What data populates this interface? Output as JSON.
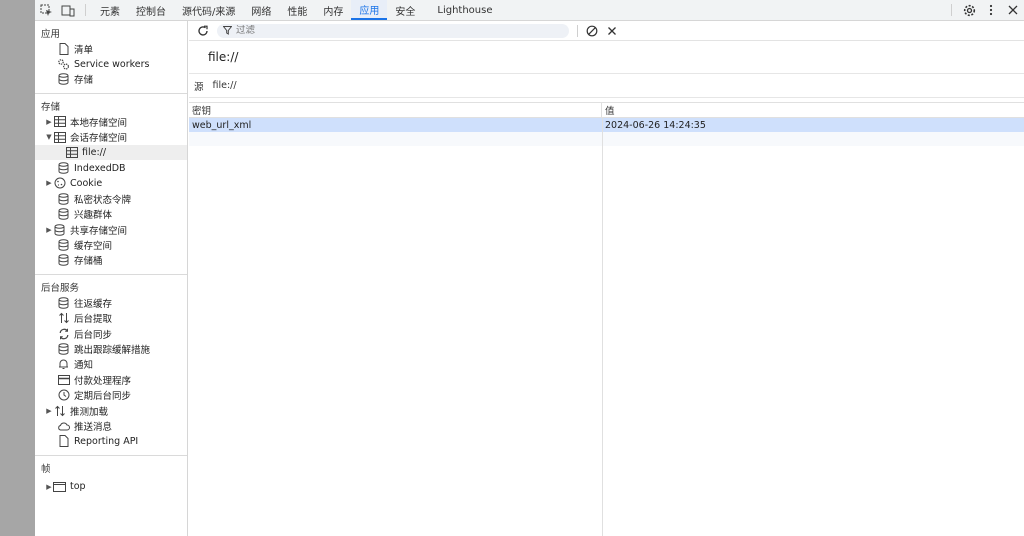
{
  "toolbar": {
    "tabs": [
      {
        "label": "元素"
      },
      {
        "label": "控制台"
      },
      {
        "label": "源代码/来源"
      },
      {
        "label": "网络"
      },
      {
        "label": "性能"
      },
      {
        "label": "内存"
      },
      {
        "label": "应用"
      },
      {
        "label": "安全"
      },
      {
        "label": "Lighthouse"
      }
    ],
    "active_tab": "应用"
  },
  "sidebar": {
    "app": {
      "title": "应用",
      "items": [
        {
          "label": "清单",
          "icon": "file-icon"
        },
        {
          "label": "Service workers",
          "icon": "gears-icon"
        },
        {
          "label": "存储",
          "icon": "database-icon"
        }
      ]
    },
    "storage": {
      "title": "存储",
      "items": [
        {
          "label": "本地存储空间",
          "icon": "table-icon"
        },
        {
          "label": "会话存储空间",
          "icon": "table-icon"
        },
        {
          "label": "file://",
          "icon": "table-icon"
        },
        {
          "label": "IndexedDB",
          "icon": "database-icon"
        },
        {
          "label": "Cookie",
          "icon": "cookie-icon"
        },
        {
          "label": "私密状态令牌",
          "icon": "database-icon"
        },
        {
          "label": "兴趣群体",
          "icon": "database-icon"
        },
        {
          "label": "共享存储空间",
          "icon": "database-icon"
        },
        {
          "label": "缓存空间",
          "icon": "database-icon"
        },
        {
          "label": "存储桶",
          "icon": "database-icon"
        }
      ]
    },
    "background": {
      "title": "后台服务",
      "items": [
        {
          "label": "往返缓存",
          "icon": "database-icon"
        },
        {
          "label": "后台提取",
          "icon": "updown-arrows-icon"
        },
        {
          "label": "后台同步",
          "icon": "sync-icon"
        },
        {
          "label": "跳出跟踪缓解措施",
          "icon": "database-icon"
        },
        {
          "label": "通知",
          "icon": "bell-icon"
        },
        {
          "label": "付款处理程序",
          "icon": "card-icon"
        },
        {
          "label": "定期后台同步",
          "icon": "clock-icon"
        },
        {
          "label": "推测加载",
          "icon": "updown-arrows-icon"
        },
        {
          "label": "推送消息",
          "icon": "cloud-icon"
        },
        {
          "label": "Reporting API",
          "icon": "file-icon"
        }
      ]
    },
    "frames": {
      "title": "帧",
      "items": [
        {
          "label": "top",
          "icon": "window-icon"
        }
      ]
    }
  },
  "main": {
    "filter_placeholder": "过滤",
    "origin_title": "file://",
    "origin_label": "源",
    "origin_value": "file://",
    "columns": {
      "key": "密钥",
      "value": "值"
    },
    "rows": [
      {
        "key": "web_url_xml",
        "value": "2024-06-26 14:24:35"
      }
    ]
  },
  "colors": {
    "accent": "#1a73e8",
    "selected_row": "#cfe0fc"
  }
}
